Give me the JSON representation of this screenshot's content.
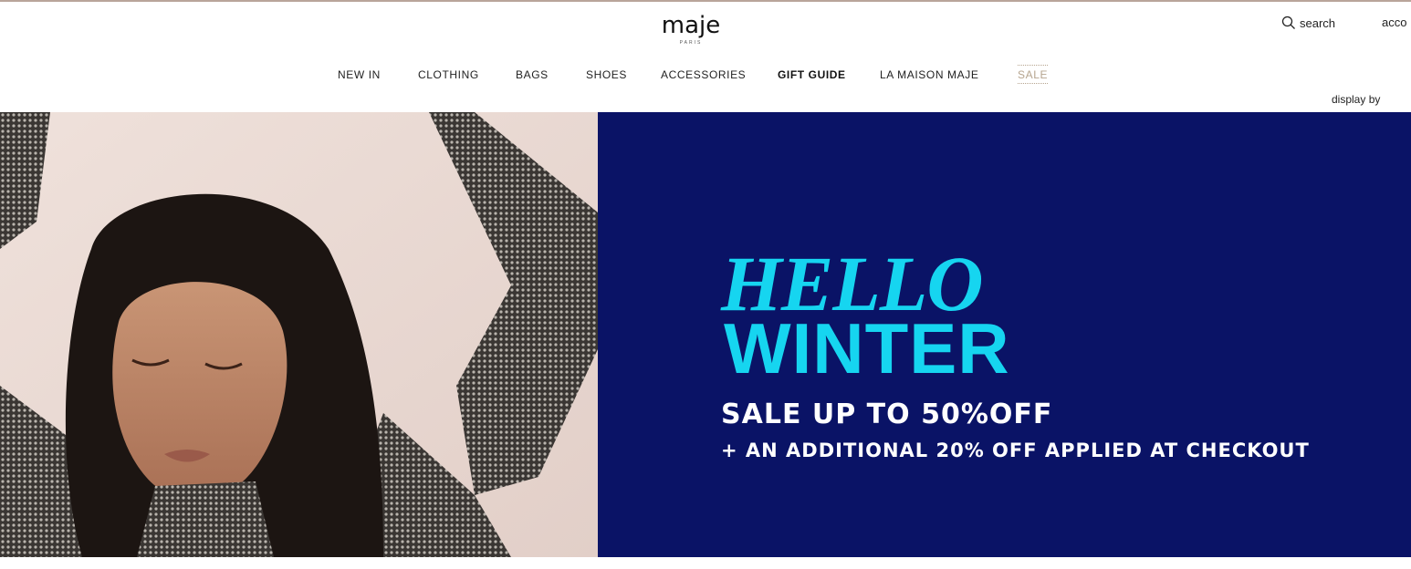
{
  "brand": {
    "name": "maje",
    "tagline": "PARIS"
  },
  "utility": {
    "search_label": "search",
    "account_label": "acco"
  },
  "nav": {
    "items": [
      {
        "label": "NEW IN"
      },
      {
        "label": "CLOTHING"
      },
      {
        "label": "BAGS"
      },
      {
        "label": "SHOES"
      },
      {
        "label": "ACCESSORIES"
      },
      {
        "label": "GIFT GUIDE"
      },
      {
        "label": "LA MAISON MAJE"
      },
      {
        "label": "SALE"
      }
    ]
  },
  "display_by_label": "display by",
  "hero": {
    "headline_line1": "HELLO",
    "headline_line2": "WINTER",
    "offer": "SALE UP TO 50%OFF",
    "additional_offer": "+ AN ADDITIONAL 20% OFF APPLIED AT CHECKOUT",
    "panel_color": "#0a1366",
    "headline_color": "#16d5f0"
  },
  "colors": {
    "sale_nav": "#b6a58f",
    "top_rule": "#b9a59a"
  }
}
